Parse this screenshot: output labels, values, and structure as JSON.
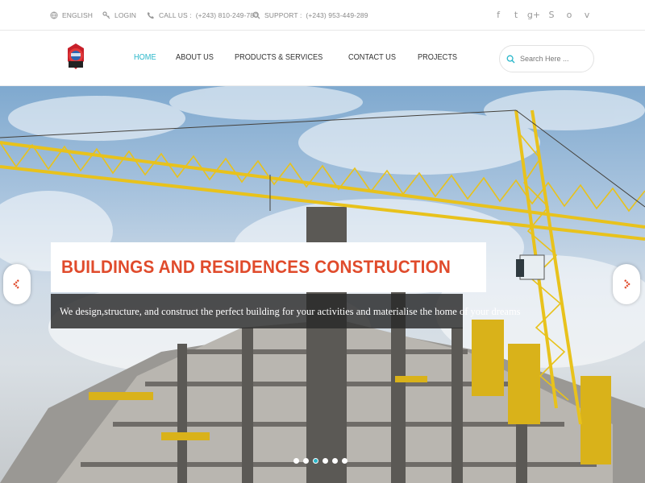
{
  "topbar": {
    "language": "ENGLISH",
    "login": "LOGIN",
    "call_label": "CALL US :",
    "call_number": "(+243) 810-249-780",
    "support_label": "SUPPORT :",
    "support_number": "(+243) 953-449-289",
    "socials": [
      {
        "icon": "facebook-icon",
        "glyph": "f"
      },
      {
        "icon": "twitter-icon",
        "glyph": "t"
      },
      {
        "icon": "google-plus-icon",
        "glyph": "g+"
      },
      {
        "icon": "skype-icon",
        "glyph": "S"
      },
      {
        "icon": "circle-logo-icon",
        "glyph": "o"
      },
      {
        "icon": "vimeo-icon",
        "glyph": "v"
      }
    ]
  },
  "nav": {
    "items": [
      {
        "label": "HOME",
        "active": true
      },
      {
        "label": "ABOUT US",
        "active": false
      },
      {
        "label": "PRODUCTS & SERVICES",
        "active": false
      },
      {
        "label": "CONTACT US",
        "active": false
      },
      {
        "label": "PROJECTS",
        "active": false
      }
    ],
    "search_placeholder": "Search Here ..."
  },
  "hero": {
    "title": "BUILDINGS AND RESIDENCES CONSTRUCTION",
    "subtitle": "We design,structure, and construct the perfect building for your activities and materialise the home of your dreams",
    "dots_total": 6,
    "dots_active_index": 2
  },
  "colors": {
    "accent": "#2ab7ca",
    "title_red": "#e04b2c",
    "crane_yellow": "#e8c21c"
  }
}
